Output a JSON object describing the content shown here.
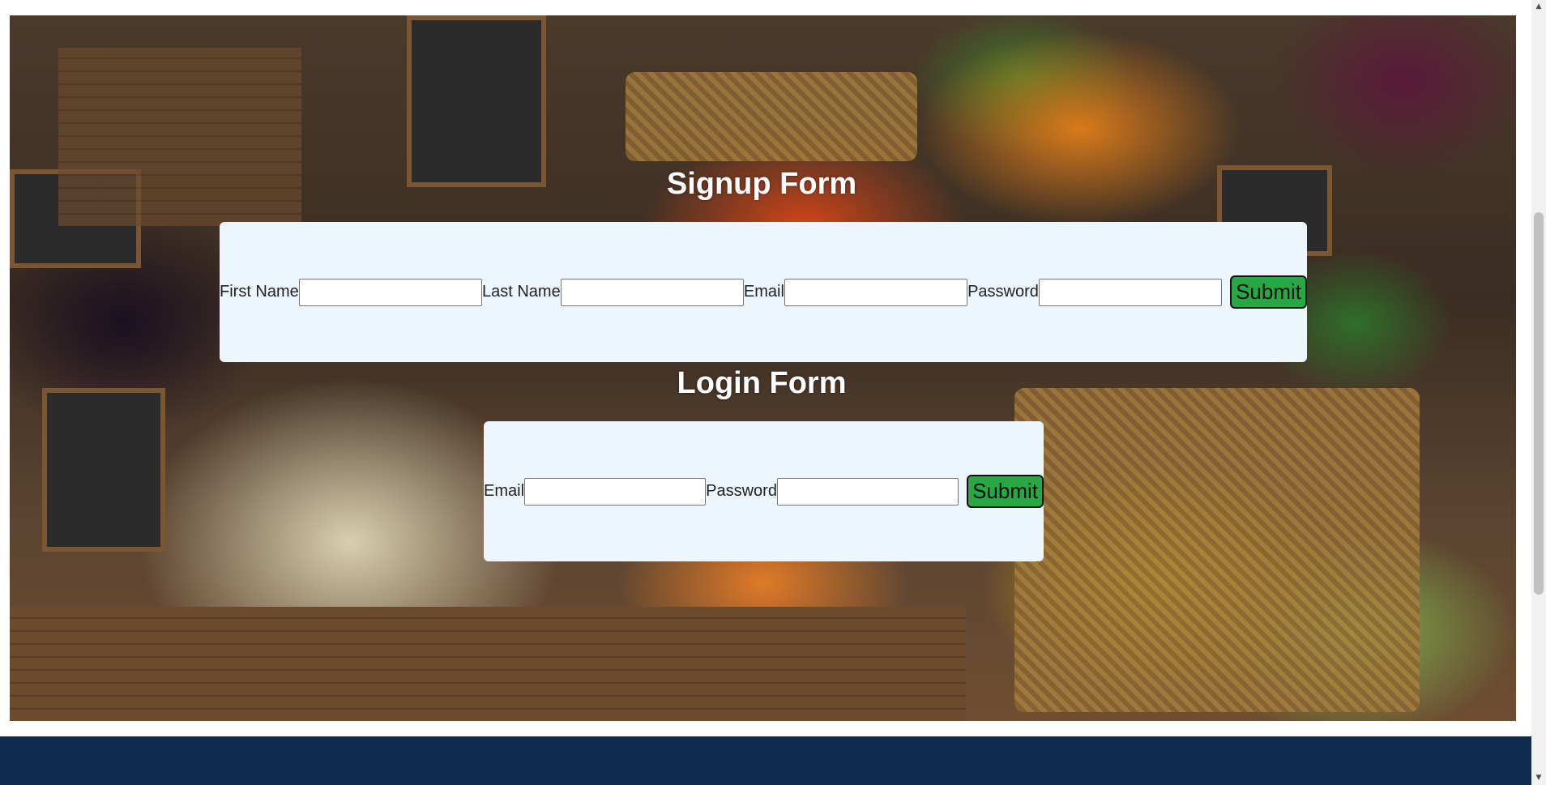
{
  "signup": {
    "title": "Signup Form",
    "first_name_label": "First Name",
    "last_name_label": "Last Name",
    "email_label": "Email",
    "password_label": "Password",
    "submit_label": "Submit"
  },
  "login": {
    "title": "Login Form",
    "email_label": "Email",
    "password_label": "Password",
    "submit_label": "Submit"
  },
  "colors": {
    "form_background": "#eef6fd",
    "submit_button": "#28a745",
    "footer": "#0f2c4f"
  },
  "scrollbar": {
    "up_icon": "scroll-up-arrow-icon",
    "down_icon": "scroll-down-arrow-icon"
  }
}
